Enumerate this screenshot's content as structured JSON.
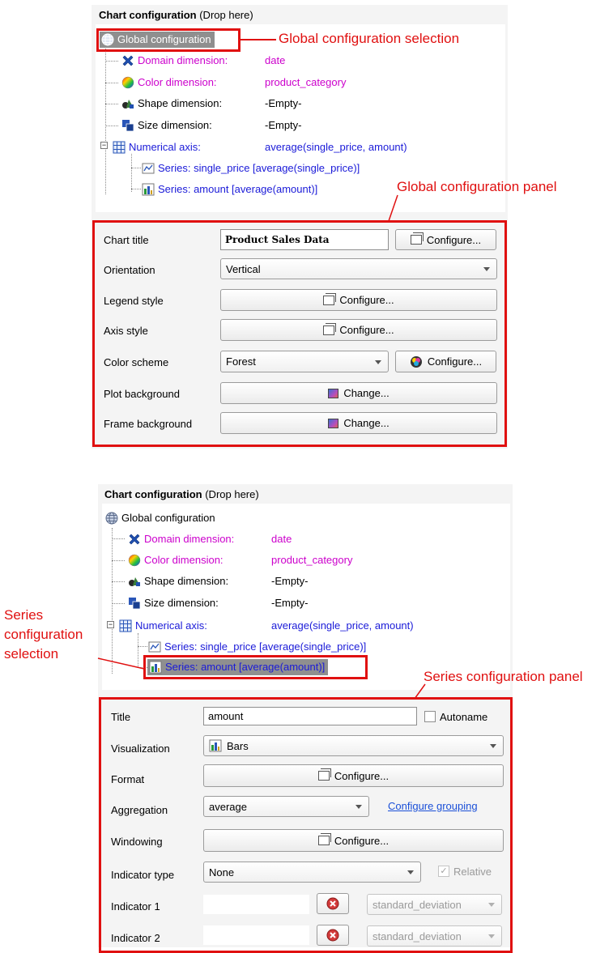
{
  "top": {
    "header_bold": "Chart configuration",
    "header_rest": " (Drop here)",
    "tree": {
      "global": "Global configuration",
      "domain_label": "Domain dimension:",
      "domain_value": "date",
      "color_label": "Color dimension:",
      "color_value": "product_category",
      "shape_label": "Shape dimension:",
      "shape_value": "-Empty-",
      "size_label": "Size dimension:",
      "size_value": "-Empty-",
      "axis_label": "Numerical axis:",
      "axis_value": "average(single_price, amount)",
      "series1": "Series: single_price [average(single_price)]",
      "series2": "Series: amount [average(amount)]"
    },
    "annotation_selection": "Global configuration selection",
    "annotation_panel": "Global configuration panel",
    "panel": {
      "chart_title_label": "Chart title",
      "chart_title_value": "Product Sales Data",
      "configure": "Configure...",
      "orientation_label": "Orientation",
      "orientation_value": "Vertical",
      "legend_label": "Legend style",
      "axis_style_label": "Axis style",
      "color_scheme_label": "Color scheme",
      "color_scheme_value": "Forest",
      "plot_bg_label": "Plot background",
      "frame_bg_label": "Frame background",
      "change": "Change..."
    }
  },
  "bottom": {
    "header_bold": "Chart configuration",
    "header_rest": " (Drop here)",
    "tree": {
      "global": "Global configuration",
      "domain_label": "Domain dimension:",
      "domain_value": "date",
      "color_label": "Color dimension:",
      "color_value": "product_category",
      "shape_label": "Shape dimension:",
      "shape_value": "-Empty-",
      "size_label": "Size dimension:",
      "size_value": "-Empty-",
      "axis_label": "Numerical axis:",
      "axis_value": "average(single_price, amount)",
      "series1": "Series: single_price [average(single_price)]",
      "series2": "Series: amount [average(amount)]"
    },
    "annotation_selection_l1": "Series",
    "annotation_selection_l2": "configuration",
    "annotation_selection_l3": "selection",
    "annotation_panel": "Series configuration panel",
    "panel": {
      "title_label": "Title",
      "title_value": "amount",
      "autoname_label": "Autoname",
      "visualization_label": "Visualization",
      "visualization_value": "Bars",
      "format_label": "Format",
      "configure": "Configure...",
      "aggregation_label": "Aggregation",
      "aggregation_value": "average",
      "configure_grouping": "Configure grouping",
      "windowing_label": "Windowing",
      "indicator_type_label": "Indicator type",
      "indicator_type_value": "None",
      "relative_label": "Relative",
      "indicator1_label": "Indicator 1",
      "indicator1_value": "standard_deviation",
      "indicator2_label": "Indicator 2",
      "indicator2_value": "standard_deviation"
    }
  }
}
